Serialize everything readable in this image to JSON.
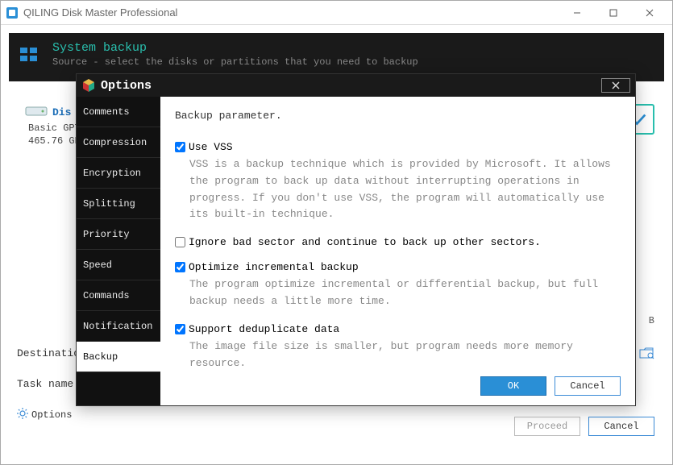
{
  "app": {
    "title": "QILING Disk Master Professional"
  },
  "header": {
    "title": "System backup",
    "subtitle": "Source - select the disks or partitions that you need to backup"
  },
  "disk": {
    "name": "Dis",
    "type": "Basic GPT",
    "size": "465.76 GB"
  },
  "kb_label": "B",
  "form": {
    "destination_label": "Destination:",
    "task_label": "Task name:"
  },
  "options_link": "Options",
  "main_buttons": {
    "proceed": "Proceed",
    "cancel": "Cancel"
  },
  "modal": {
    "title": "Options",
    "sidebar": [
      {
        "label": "Comments"
      },
      {
        "label": "Compression"
      },
      {
        "label": "Encryption"
      },
      {
        "label": "Splitting"
      },
      {
        "label": "Priority"
      },
      {
        "label": "Speed"
      },
      {
        "label": "Commands"
      },
      {
        "label": "Notification"
      },
      {
        "label": "Backup"
      }
    ],
    "panel": {
      "title": "Backup parameter.",
      "opts": [
        {
          "label": "Use VSS",
          "checked": true,
          "desc": "VSS is a backup technique which is provided by Microsoft. It allows the program to back up data without interrupting operations in progress. If you don't use VSS, the program will automatically use its built-in technique."
        },
        {
          "label": "Ignore bad sector and continue to back up other sectors.",
          "checked": false,
          "desc": ""
        },
        {
          "label": "Optimize incremental backup",
          "checked": true,
          "desc": "The program optimize incremental or differential backup, but full backup needs a little more time."
        },
        {
          "label": "Support deduplicate data",
          "checked": true,
          "desc": "The image file size is smaller, but program needs more memory resource."
        }
      ],
      "ok": "OK",
      "cancel": "Cancel"
    }
  }
}
